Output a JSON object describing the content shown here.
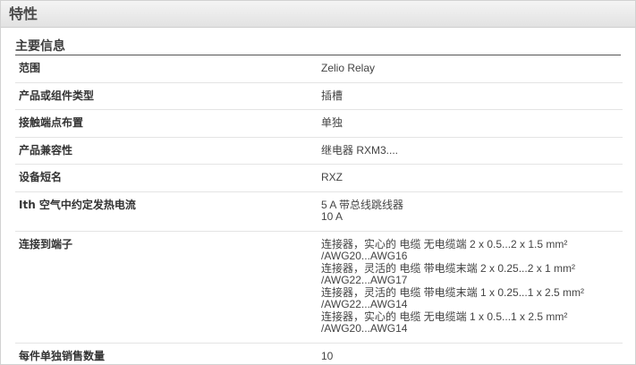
{
  "header": {
    "title": "特性"
  },
  "section": {
    "title": "主要信息"
  },
  "rows": [
    {
      "label": "范围",
      "values": [
        "Zelio Relay"
      ]
    },
    {
      "label": "产品或组件类型",
      "values": [
        "插槽"
      ]
    },
    {
      "label": "接触端点布置",
      "values": [
        "单独"
      ]
    },
    {
      "label": "产品兼容性",
      "values": [
        "继电器 RXM3...."
      ]
    },
    {
      "label": "设备短名",
      "values": [
        "RXZ"
      ]
    },
    {
      "label": "Ith 空气中约定发热电流",
      "values": [
        "5 A 带总线跳线器",
        "10 A"
      ]
    },
    {
      "label": "连接到端子",
      "values": [
        "连接器，实心的 电缆 无电缆端 2 x 0.5...2 x 1.5 mm²",
        "/AWG20...AWG16",
        "连接器，灵活的 电缆 带电缆末端 2 x 0.25...2 x 1 mm²",
        "/AWG22...AWG17",
        "连接器，灵活的 电缆 带电缆末端 1 x 0.25...1 x 2.5 mm²",
        "/AWG22...AWG14",
        "连接器，实心的 电缆 无电缆端 1 x 0.5...1 x 2.5 mm²",
        "/AWG20...AWG14"
      ]
    },
    {
      "label": "每件单独销售数量",
      "values": [
        "10"
      ]
    }
  ]
}
